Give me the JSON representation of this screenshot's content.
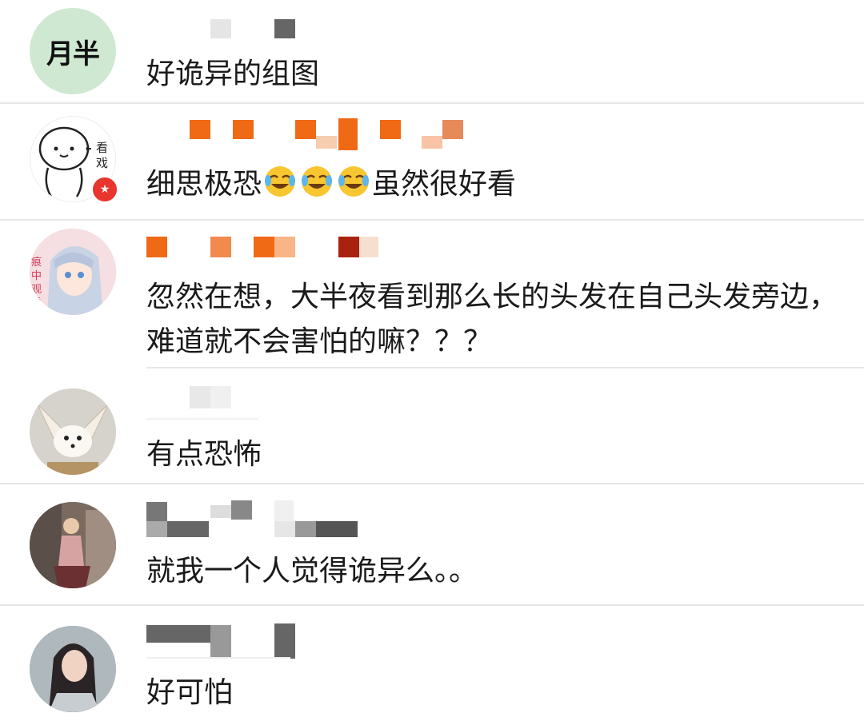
{
  "comments": [
    {
      "avatar": {
        "type": "text",
        "text": "月半",
        "bg": "#cfe8d2"
      },
      "text": "好诡异的组图"
    },
    {
      "avatar": {
        "type": "cartoon",
        "side_text": "看戏",
        "bg": "#ffffff"
      },
      "text_before": "细思极恐",
      "emoji": [
        "laugh-cry-emoji",
        "laugh-cry-emoji",
        "laugh-cry-emoji"
      ],
      "text_after": "虽然很好看"
    },
    {
      "avatar": {
        "type": "anime",
        "side_text": "痕中观看",
        "bg": "#f2d7d9"
      },
      "text": "忽然在想，大半夜看到那么长的头发在自己头发旁边，难道就不会害怕的嘛？？？"
    },
    {
      "avatar": {
        "type": "fox",
        "bg": "#d9d6cf"
      },
      "text": "有点恐怖"
    },
    {
      "avatar": {
        "type": "photo-street",
        "bg": "#8a6a5c"
      },
      "text": "就我一个人觉得诡异么。。"
    },
    {
      "avatar": {
        "type": "photo-portrait",
        "bg": "#9aa6ad"
      },
      "text": "好可怕"
    }
  ],
  "colors": {
    "divider": "#e6e6e6",
    "orange": "#f06a16",
    "text": "#1a1a1a"
  }
}
